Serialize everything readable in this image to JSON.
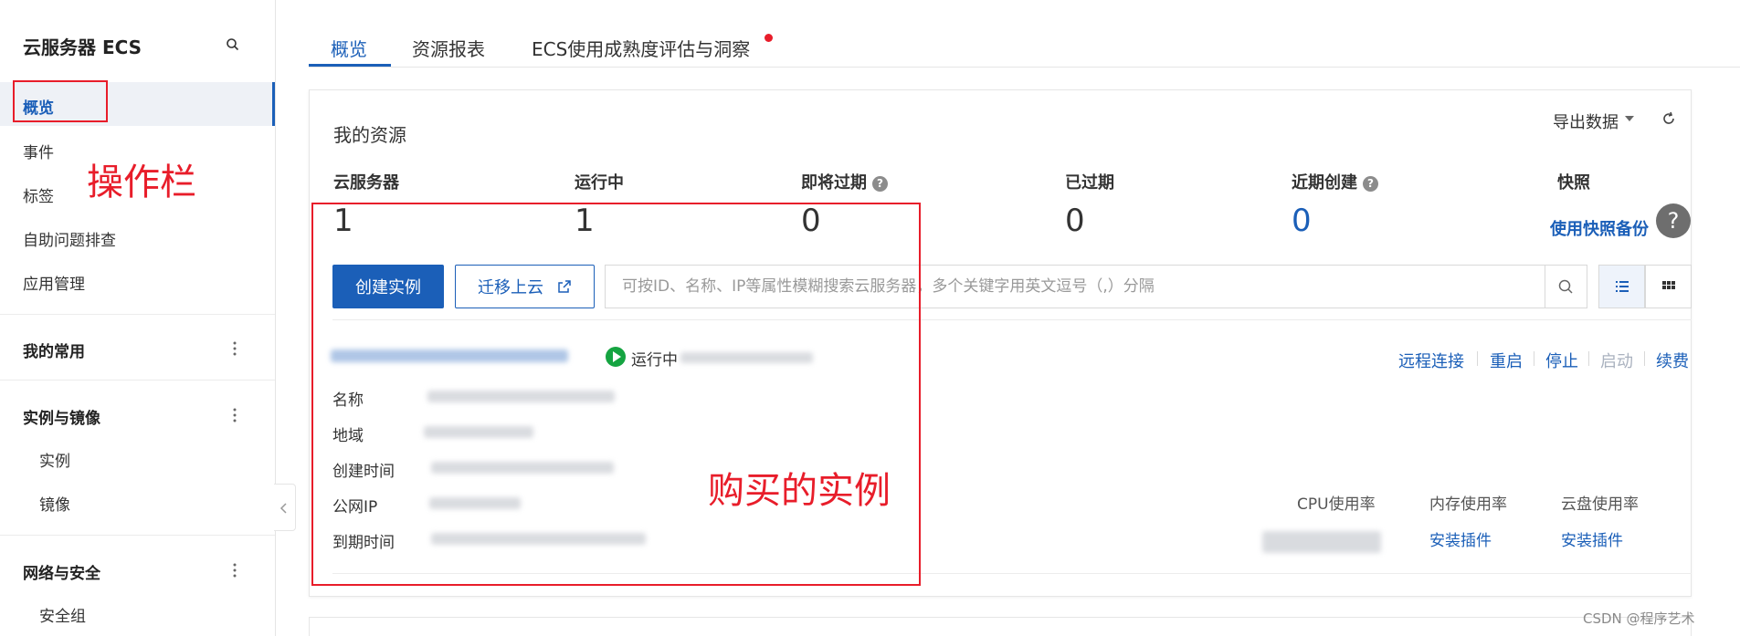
{
  "sidebar": {
    "title": "云服务器 ECS",
    "items": [
      {
        "label": "概览"
      },
      {
        "label": "事件"
      },
      {
        "label": "标签"
      },
      {
        "label": "自助问题排查"
      },
      {
        "label": "应用管理"
      }
    ],
    "groups": [
      {
        "label": "我的常用",
        "children": []
      },
      {
        "label": "实例与镜像",
        "children": [
          "实例",
          "镜像"
        ]
      },
      {
        "label": "网络与安全",
        "children": [
          "安全组"
        ]
      }
    ],
    "annotation": "操作栏"
  },
  "tabs": [
    {
      "label": "概览",
      "active": true
    },
    {
      "label": "资源报表",
      "active": false
    },
    {
      "label": "ECS使用成熟度评估与洞察",
      "active": false,
      "badge_color": "#e81d2a"
    }
  ],
  "resources": {
    "title": "我的资源",
    "export_label": "导出数据",
    "stats": [
      {
        "label": "云服务器",
        "value": "1"
      },
      {
        "label": "运行中",
        "value": "1"
      },
      {
        "label": "即将过期",
        "value": "0"
      },
      {
        "label": "已过期",
        "value": "0"
      },
      {
        "label": "近期创建",
        "value": "0"
      },
      {
        "label": "快照",
        "link": "使用快照备份"
      }
    ]
  },
  "toolbar": {
    "create_label": "创建实例",
    "migrate_label": "迁移上云",
    "search_placeholder": "可按ID、名称、IP等属性模糊搜索云服务器，多个关键字用英文逗号（,）分隔"
  },
  "instance": {
    "status": "运行中",
    "actions": [
      "远程连接",
      "重启",
      "停止",
      "启动",
      "续费"
    ],
    "fields": [
      "名称",
      "地域",
      "创建时间",
      "公网IP",
      "到期时间"
    ],
    "usage": [
      {
        "label": "CPU使用率"
      },
      {
        "label": "内存使用率",
        "link": "安装插件"
      },
      {
        "label": "云盘使用率",
        "link": "安装插件"
      }
    ],
    "annotation": "购买的实例"
  },
  "watermark": "CSDN @程序艺术",
  "colors": {
    "accent": "#1b5fb8",
    "annotation": "#e81d2a",
    "running": "#15a441"
  }
}
